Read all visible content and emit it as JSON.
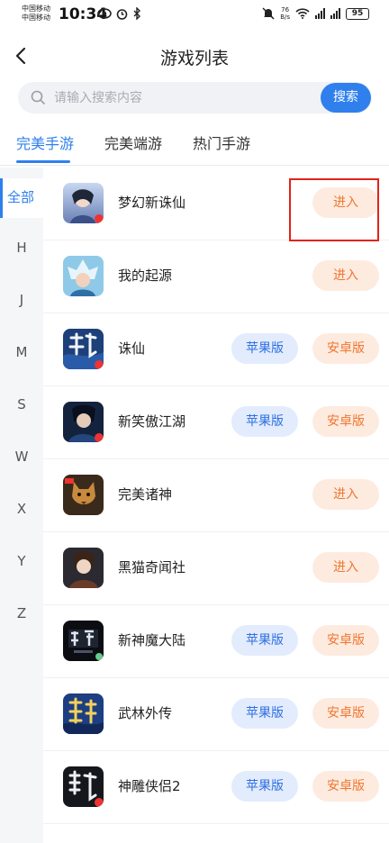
{
  "status_bar": {
    "carrier_1": "中国移动",
    "carrier_2": "中国移动",
    "time": "10:34",
    "net_speed_value": "76",
    "net_speed_unit": "B/s",
    "network_1": "4G",
    "network_2": "4G",
    "battery": "95"
  },
  "header": {
    "title": "游戏列表"
  },
  "search": {
    "placeholder": "请输入搜索内容",
    "button_label": "搜索"
  },
  "tabs": [
    {
      "label": "完美手游",
      "active": true
    },
    {
      "label": "完美端游",
      "active": false
    },
    {
      "label": "热门手游",
      "active": false
    }
  ],
  "index": {
    "all_label": "全部",
    "letters": [
      "H",
      "J",
      "M",
      "S",
      "W",
      "X",
      "Y",
      "Z"
    ]
  },
  "games": [
    {
      "name": "梦幻新诛仙",
      "enter_label": "进入"
    },
    {
      "name": "我的起源",
      "enter_label": "进入"
    },
    {
      "name": "诛仙",
      "ios_label": "苹果版",
      "android_label": "安卓版"
    },
    {
      "name": "新笑傲江湖",
      "ios_label": "苹果版",
      "android_label": "安卓版"
    },
    {
      "name": "完美诸神",
      "enter_label": "进入"
    },
    {
      "name": "黑猫奇闻社",
      "enter_label": "进入"
    },
    {
      "name": "新神魔大陆",
      "ios_label": "苹果版",
      "android_label": "安卓版"
    },
    {
      "name": "武林外传",
      "ios_label": "苹果版",
      "android_label": "安卓版"
    },
    {
      "name": "神雕侠侣2",
      "ios_label": "苹果版",
      "android_label": "安卓版"
    }
  ],
  "colors": {
    "accent": "#2f80ed",
    "enter_bg": "#fdebe0",
    "enter_text": "#f0762e",
    "ios_bg": "#e2ecfd",
    "highlight_border": "#e2231a"
  },
  "icons": {
    "back": "chevron-left-icon",
    "search": "search-icon"
  }
}
